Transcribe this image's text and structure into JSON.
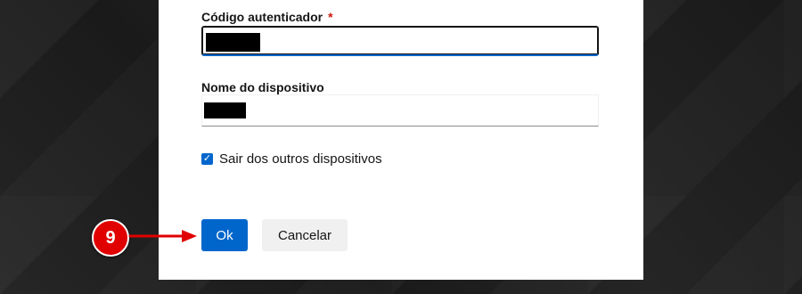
{
  "form": {
    "auth_code_label": "Código autenticador",
    "auth_code_required_mark": "*",
    "device_name_label": "Nome do dispositivo",
    "logout_others_label": "Sair dos outros dispositivos",
    "logout_others_checked": true
  },
  "buttons": {
    "ok_label": "Ok",
    "cancel_label": "Cancelar"
  },
  "annotation": {
    "step_number": "9"
  },
  "colors": {
    "primary": "#0066cc",
    "required": "#c9190b",
    "annotation": "#e00000"
  }
}
